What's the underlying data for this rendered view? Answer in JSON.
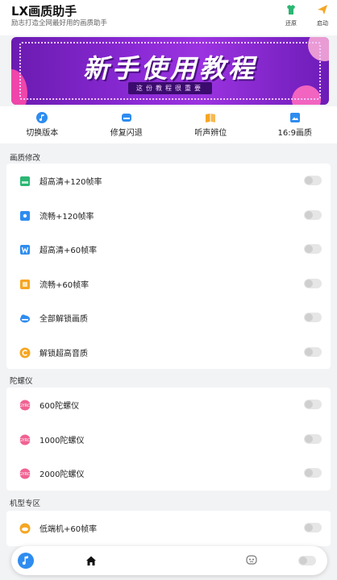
{
  "header": {
    "title": "LX画质助手",
    "subtitle": "励志打造全网最好用的画质助手",
    "restore_label": "还原",
    "launch_label": "启动"
  },
  "banner": {
    "title": "新手使用教程",
    "subtitle": "这份教程很重要"
  },
  "quick_actions": [
    {
      "label": "切换版本",
      "icon": "music-note-icon",
      "color": "#2e8cf0"
    },
    {
      "label": "修复闪退",
      "icon": "cloud-icon",
      "color": "#2e8cf0"
    },
    {
      "label": "听声辨位",
      "icon": "book-icon",
      "color": "#f5a623"
    },
    {
      "label": "16:9画质",
      "icon": "picture-icon",
      "color": "#2e8cf0"
    }
  ],
  "sections": {
    "quality": {
      "title": "画质修改",
      "items": [
        {
          "label": "超高清+120帧率",
          "icon": "square-green-icon",
          "color": "#2bb673"
        },
        {
          "label": "流畅+120帧率",
          "icon": "square-blue-icon",
          "color": "#2e8cf0"
        },
        {
          "label": "超高清+60帧率",
          "icon": "w-square-icon",
          "color": "#2e8cf0"
        },
        {
          "label": "流畅+60帧率",
          "icon": "square-yellow-icon",
          "color": "#f5a623"
        },
        {
          "label": "全部解锁画质",
          "icon": "cloud-unlock-icon",
          "color": "#2e8cf0"
        },
        {
          "label": "解锁超高音质",
          "icon": "circle-orange-icon",
          "color": "#f5a623"
        }
      ]
    },
    "gyro": {
      "title": "陀螺仪",
      "items": [
        {
          "label": "600陀螺仪",
          "icon": "gyro-pink-icon",
          "color": "#f06292"
        },
        {
          "label": "1000陀螺仪",
          "icon": "gyro-pink-icon",
          "color": "#f06292"
        },
        {
          "label": "2000陀螺仪",
          "icon": "gyro-pink-icon",
          "color": "#f06292"
        }
      ]
    },
    "model": {
      "title": "机型专区",
      "items": [
        {
          "label": "低端机+60帧率",
          "icon": "cloud-orange-icon",
          "color": "#f5a623"
        }
      ]
    }
  }
}
